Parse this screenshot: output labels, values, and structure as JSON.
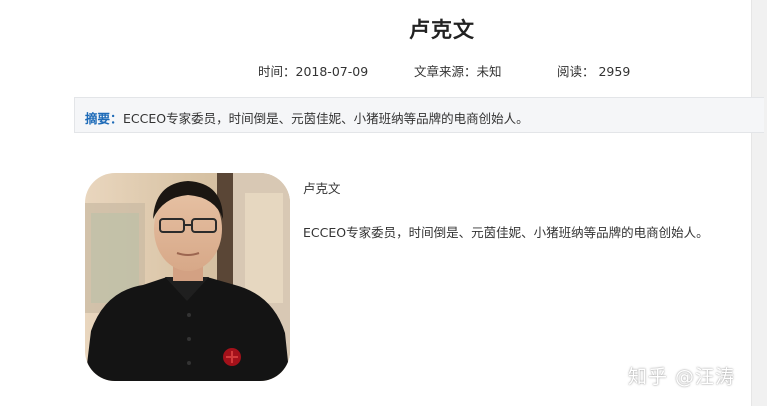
{
  "article": {
    "title": "卢克文",
    "meta": {
      "time": "时间：2018-07-09",
      "source": "文章来源：未知",
      "reads": "阅读： 2959"
    },
    "summary": {
      "label": "摘要：",
      "text": "ECCEO专家委员，时间倒是、元茵佳妮、小猪班纳等品牌的电商创始人。"
    },
    "body": {
      "name": "卢克文",
      "description": "ECCEO专家委员，时间倒是、元茵佳妮、小猪班纳等品牌的电商创始人。"
    }
  },
  "watermark": "知乎 @汪涛",
  "colors": {
    "summary_label": "#1e6bb8",
    "summary_bg": "#f5f6f8",
    "text": "#333333"
  }
}
